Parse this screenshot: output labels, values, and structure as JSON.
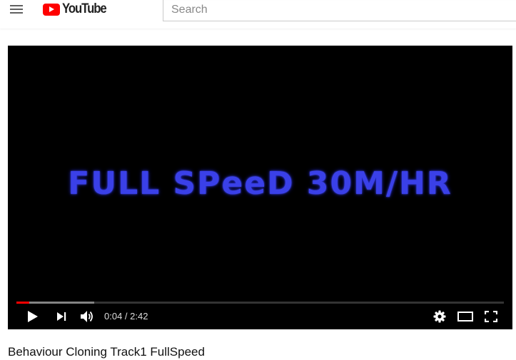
{
  "header": {
    "logo_text": "YouTube",
    "search": {
      "placeholder": "Search",
      "value": ""
    }
  },
  "player": {
    "overlay_text": "FULL SPeeD 30M/HR",
    "time": {
      "current": "0:04",
      "separator": " / ",
      "duration": "2:42"
    },
    "progress": {
      "played_fraction": 0.027,
      "loaded_fraction": 0.16
    }
  },
  "video": {
    "title": "Behaviour Cloning Track1 FullSpeed"
  },
  "colors": {
    "brand_red": "#ff0000",
    "overlay_blue": "#3a40e8"
  },
  "icons": {
    "menu": "hamburger-menu-icon",
    "play": "play-icon",
    "next": "next-icon",
    "volume": "volume-icon",
    "settings": "gear-icon",
    "theater": "theater-mode-icon",
    "fullscreen": "fullscreen-icon"
  }
}
